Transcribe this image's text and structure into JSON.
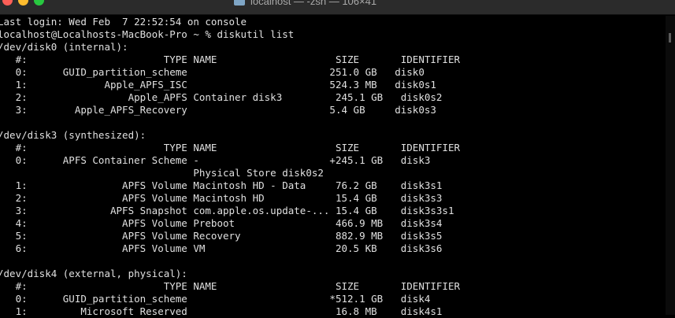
{
  "window": {
    "title": "localhost — -zsh — 106×41"
  },
  "terminal": {
    "lines": [
      "Last login: Wed Feb  7 22:52:54 on console",
      "localhost@Localhosts-MacBook-Pro ~ % diskutil list",
      "/dev/disk0 (internal):",
      "   #:                       TYPE NAME                    SIZE       IDENTIFIER",
      "   0:      GUID_partition_scheme                        251.0 GB   disk0",
      "   1:             Apple_APFS_ISC                        524.3 MB   disk0s1",
      "   2:                 Apple_APFS Container disk3         245.1 GB   disk0s2",
      "   3:        Apple_APFS_Recovery                        5.4 GB     disk0s3",
      "",
      "/dev/disk3 (synthesized):",
      "   #:                       TYPE NAME                    SIZE       IDENTIFIER",
      "   0:      APFS Container Scheme -                      +245.1 GB   disk3",
      "                                 Physical Store disk0s2",
      "   1:                APFS Volume Macintosh HD - Data     76.2 GB    disk3s1",
      "   2:                APFS Volume Macintosh HD            15.4 GB    disk3s3",
      "   3:              APFS Snapshot com.apple.os.update-... 15.4 GB    disk3s3s1",
      "   4:                APFS Volume Preboot                 466.9 MB   disk3s4",
      "   5:                APFS Volume Recovery                882.9 MB   disk3s5",
      "   6:                APFS Volume VM                      20.5 KB    disk3s6",
      "",
      "/dev/disk4 (external, physical):",
      "   #:                       TYPE NAME                    SIZE       IDENTIFIER",
      "   0:      GUID_partition_scheme                        *512.1 GB   disk4",
      "   1:         Microsoft Reserved                         16.8 MB    disk4s1"
    ]
  }
}
